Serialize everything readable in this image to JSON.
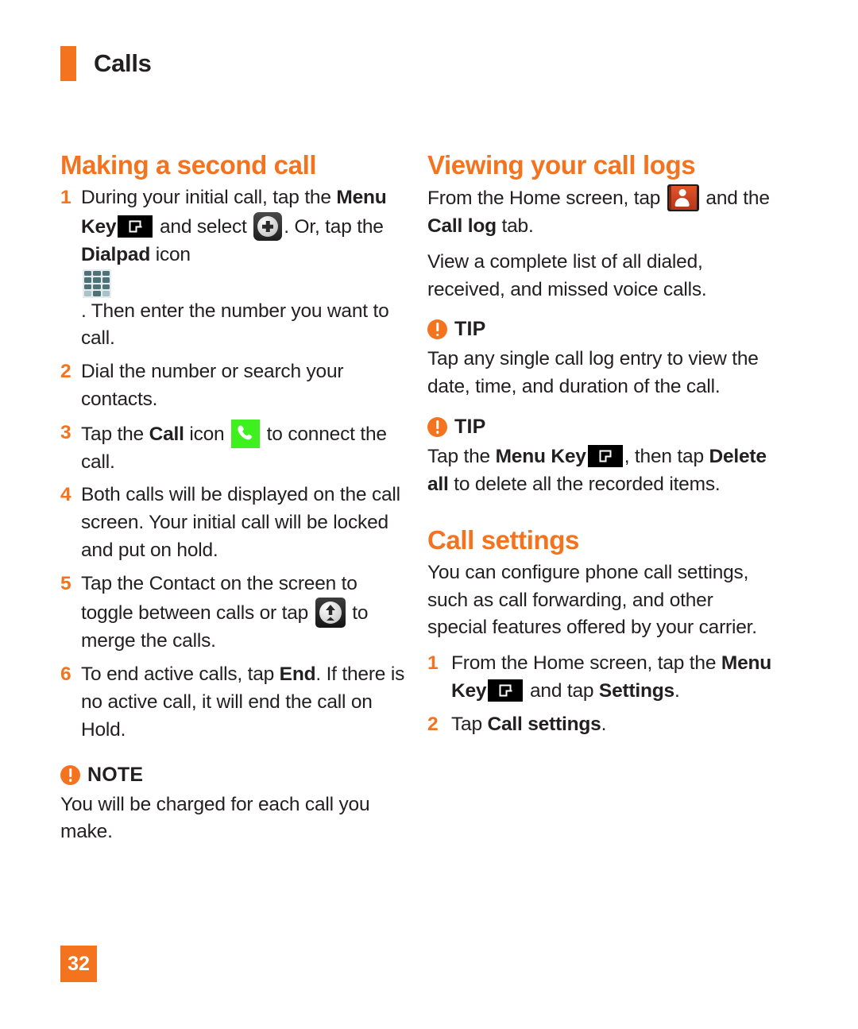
{
  "header": {
    "chapter_title": "Calls",
    "accent_color": "#F4731F"
  },
  "left_column": {
    "heading": "Making a second call",
    "steps": [
      {
        "num": "1",
        "part1": "During your initial call, tap the ",
        "bold1": "Menu Key",
        "icon1": "menu-key-icon",
        "part2": " and select ",
        "icon2": "add-call-icon",
        "part3": ". Or, tap the ",
        "bold2": "Dialpad",
        "part4": " icon ",
        "icon3": "dialpad-icon",
        "part5": ". Then enter the number you want to call."
      },
      {
        "num": "2",
        "part1": "Dial the number or search your contacts."
      },
      {
        "num": "3",
        "part1": "Tap the ",
        "bold1": "Call",
        "part2": " icon ",
        "icon1": "call-icon",
        "part3": " to connect the call."
      },
      {
        "num": "4",
        "part1": "Both calls will be displayed on the call screen. Your initial call will be locked and put on hold."
      },
      {
        "num": "5",
        "part1": "Tap the Contact on the screen to toggle between calls or tap ",
        "icon1": "merge-call-icon",
        "part2": " to merge the calls."
      },
      {
        "num": "6",
        "part1": "To end active calls, tap ",
        "bold1": "End",
        "part2": ". If there is no active call, it will end the call on Hold."
      }
    ],
    "note": {
      "icon": "exclamation-icon",
      "label": "NOTE",
      "body": "You will be charged for each call you make."
    }
  },
  "right_column": {
    "heading_call_logs": "Viewing your call logs",
    "intro": {
      "part1": "From the Home screen, tap ",
      "icon1": "contacts-icon",
      "part2": " and the ",
      "bold1": "Call log",
      "part3": " tab."
    },
    "description": "View a complete list of all dialed, received, and missed voice calls.",
    "tip1": {
      "icon": "exclamation-icon",
      "label": "TIP",
      "body": "Tap any single call log entry to view the date, time, and duration of the call."
    },
    "tip2": {
      "icon": "exclamation-icon",
      "label": "TIP",
      "part1": "Tap the ",
      "bold1": "Menu Key",
      "icon1": "menu-key-icon",
      "part2": ", then tap ",
      "bold2": "Delete all",
      "part3": " to delete all the recorded items."
    },
    "heading_call_settings": "Call settings",
    "settings_intro": "You can configure phone call settings, such as call forwarding,  and other special features offered by your carrier.",
    "settings_steps": [
      {
        "num": "1",
        "part1": "From the Home screen, tap the ",
        "bold1": "Menu Key",
        "icon1": "menu-key-icon",
        "part2": " and tap ",
        "bold2": "Settings",
        "part3": "."
      },
      {
        "num": "2",
        "part1": "Tap ",
        "bold1": "Call settings",
        "part2": "."
      }
    ]
  },
  "footer": {
    "page_number": "32"
  }
}
